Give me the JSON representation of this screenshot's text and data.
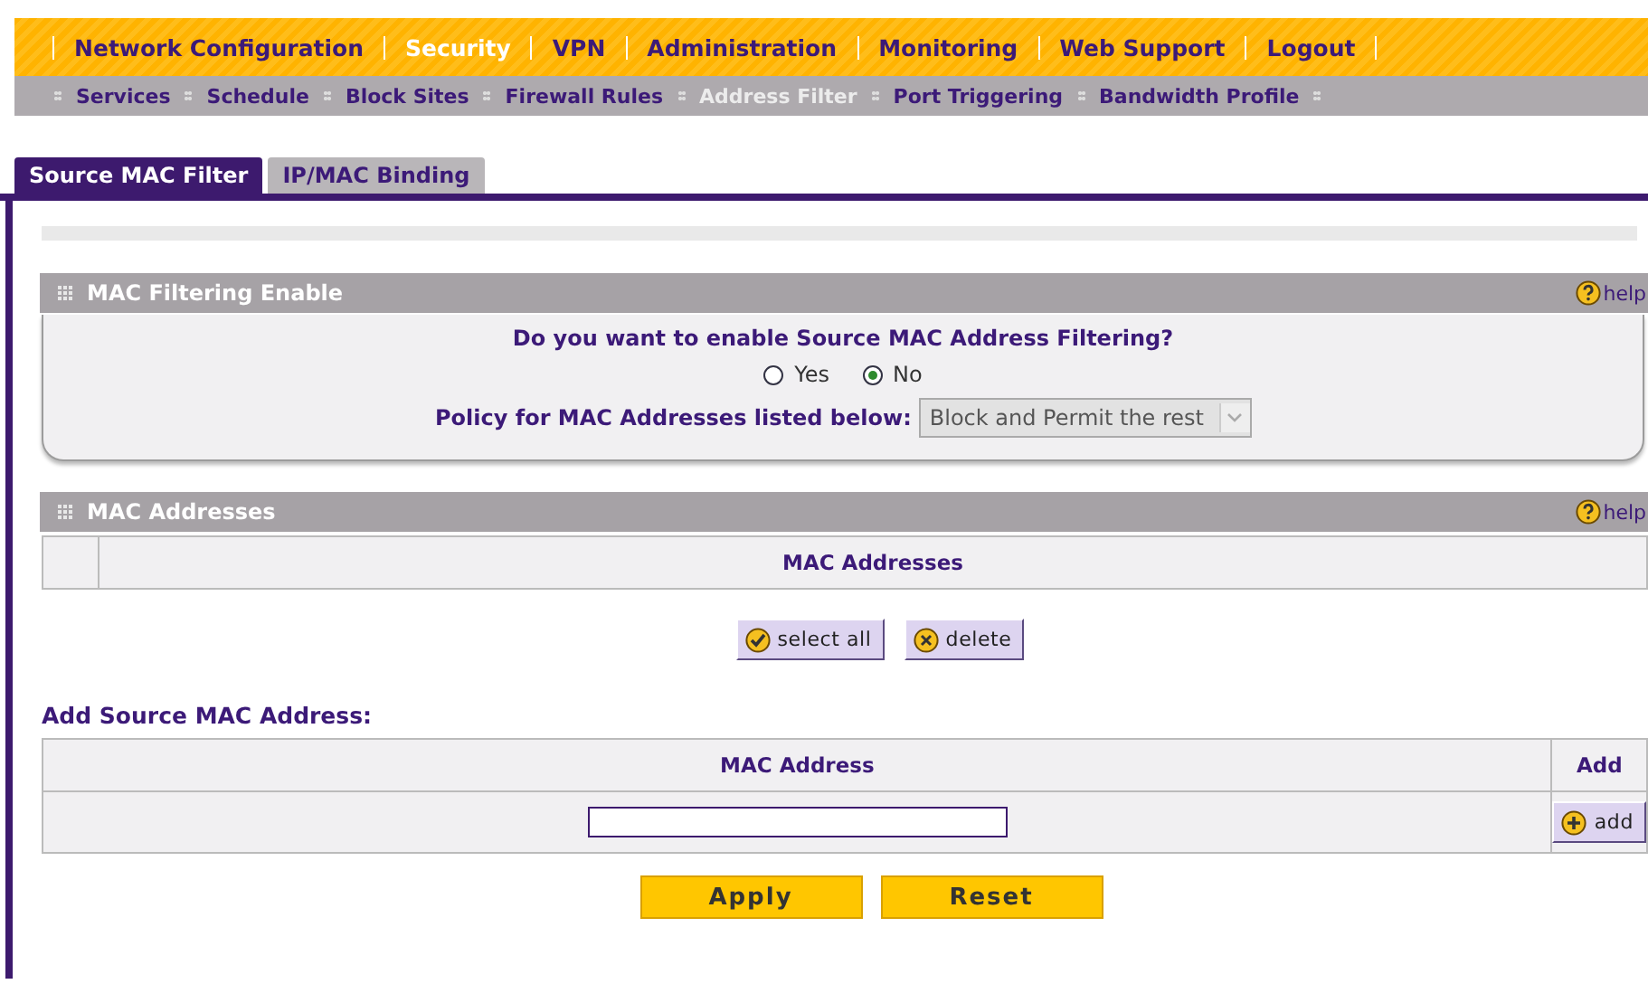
{
  "main_menu": [
    {
      "label": "Network Configuration",
      "selected": false
    },
    {
      "label": "Security",
      "selected": true
    },
    {
      "label": "VPN",
      "selected": false
    },
    {
      "label": "Administration",
      "selected": false
    },
    {
      "label": "Monitoring",
      "selected": false
    },
    {
      "label": "Web Support",
      "selected": false
    },
    {
      "label": "Logout",
      "selected": false
    }
  ],
  "sub_menu": [
    {
      "label": "Services",
      "selected": false
    },
    {
      "label": "Schedule",
      "selected": false
    },
    {
      "label": "Block Sites",
      "selected": false
    },
    {
      "label": "Firewall Rules",
      "selected": false
    },
    {
      "label": "Address Filter",
      "selected": true
    },
    {
      "label": "Port Triggering",
      "selected": false
    },
    {
      "label": "Bandwidth Profile",
      "selected": false
    }
  ],
  "tabs": [
    {
      "label": "Source MAC Filter",
      "selected": true
    },
    {
      "label": "IP/MAC Binding",
      "selected": false
    }
  ],
  "mac_filtering": {
    "title": "MAC Filtering Enable",
    "help": "help",
    "question": "Do you want to enable Source MAC Address Filtering?",
    "options": [
      {
        "label": "Yes",
        "selected": false
      },
      {
        "label": "No",
        "selected": true
      }
    ],
    "policy_label": "Policy for MAC Addresses listed below:",
    "policy_value": "Block and Permit the rest",
    "policy_disabled": true
  },
  "mac_addresses": {
    "title": "MAC Addresses",
    "help": "help",
    "columns": [
      "MAC Addresses"
    ],
    "buttons": [
      {
        "label": "select all",
        "kind": "check"
      },
      {
        "label": "delete",
        "kind": "cross"
      }
    ]
  },
  "add_section": {
    "title": "Add Source MAC Address:",
    "columns": [
      "MAC Address",
      "Add"
    ],
    "add_button": {
      "label": "add",
      "kind": "plus"
    }
  },
  "actions": [
    "Apply",
    "Reset"
  ]
}
